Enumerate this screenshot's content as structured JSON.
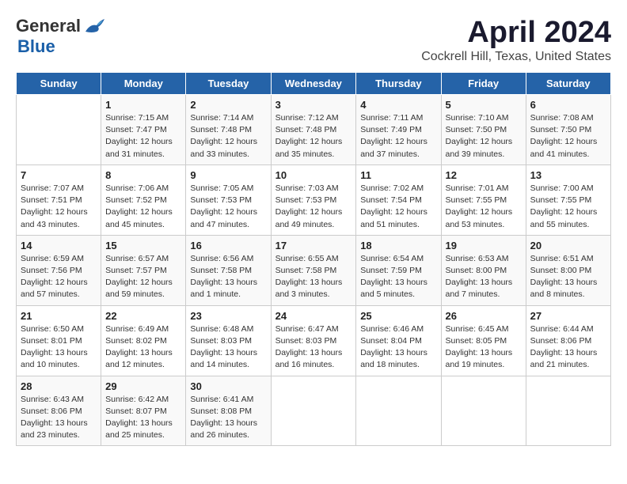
{
  "logo": {
    "general": "General",
    "blue": "Blue"
  },
  "title": "April 2024",
  "location": "Cockrell Hill, Texas, United States",
  "header_days": [
    "Sunday",
    "Monday",
    "Tuesday",
    "Wednesday",
    "Thursday",
    "Friday",
    "Saturday"
  ],
  "weeks": [
    [
      {
        "day": "",
        "info": ""
      },
      {
        "day": "1",
        "info": "Sunrise: 7:15 AM\nSunset: 7:47 PM\nDaylight: 12 hours\nand 31 minutes."
      },
      {
        "day": "2",
        "info": "Sunrise: 7:14 AM\nSunset: 7:48 PM\nDaylight: 12 hours\nand 33 minutes."
      },
      {
        "day": "3",
        "info": "Sunrise: 7:12 AM\nSunset: 7:48 PM\nDaylight: 12 hours\nand 35 minutes."
      },
      {
        "day": "4",
        "info": "Sunrise: 7:11 AM\nSunset: 7:49 PM\nDaylight: 12 hours\nand 37 minutes."
      },
      {
        "day": "5",
        "info": "Sunrise: 7:10 AM\nSunset: 7:50 PM\nDaylight: 12 hours\nand 39 minutes."
      },
      {
        "day": "6",
        "info": "Sunrise: 7:08 AM\nSunset: 7:50 PM\nDaylight: 12 hours\nand 41 minutes."
      }
    ],
    [
      {
        "day": "7",
        "info": "Sunrise: 7:07 AM\nSunset: 7:51 PM\nDaylight: 12 hours\nand 43 minutes."
      },
      {
        "day": "8",
        "info": "Sunrise: 7:06 AM\nSunset: 7:52 PM\nDaylight: 12 hours\nand 45 minutes."
      },
      {
        "day": "9",
        "info": "Sunrise: 7:05 AM\nSunset: 7:53 PM\nDaylight: 12 hours\nand 47 minutes."
      },
      {
        "day": "10",
        "info": "Sunrise: 7:03 AM\nSunset: 7:53 PM\nDaylight: 12 hours\nand 49 minutes."
      },
      {
        "day": "11",
        "info": "Sunrise: 7:02 AM\nSunset: 7:54 PM\nDaylight: 12 hours\nand 51 minutes."
      },
      {
        "day": "12",
        "info": "Sunrise: 7:01 AM\nSunset: 7:55 PM\nDaylight: 12 hours\nand 53 minutes."
      },
      {
        "day": "13",
        "info": "Sunrise: 7:00 AM\nSunset: 7:55 PM\nDaylight: 12 hours\nand 55 minutes."
      }
    ],
    [
      {
        "day": "14",
        "info": "Sunrise: 6:59 AM\nSunset: 7:56 PM\nDaylight: 12 hours\nand 57 minutes."
      },
      {
        "day": "15",
        "info": "Sunrise: 6:57 AM\nSunset: 7:57 PM\nDaylight: 12 hours\nand 59 minutes."
      },
      {
        "day": "16",
        "info": "Sunrise: 6:56 AM\nSunset: 7:58 PM\nDaylight: 13 hours\nand 1 minute."
      },
      {
        "day": "17",
        "info": "Sunrise: 6:55 AM\nSunset: 7:58 PM\nDaylight: 13 hours\nand 3 minutes."
      },
      {
        "day": "18",
        "info": "Sunrise: 6:54 AM\nSunset: 7:59 PM\nDaylight: 13 hours\nand 5 minutes."
      },
      {
        "day": "19",
        "info": "Sunrise: 6:53 AM\nSunset: 8:00 PM\nDaylight: 13 hours\nand 7 minutes."
      },
      {
        "day": "20",
        "info": "Sunrise: 6:51 AM\nSunset: 8:00 PM\nDaylight: 13 hours\nand 8 minutes."
      }
    ],
    [
      {
        "day": "21",
        "info": "Sunrise: 6:50 AM\nSunset: 8:01 PM\nDaylight: 13 hours\nand 10 minutes."
      },
      {
        "day": "22",
        "info": "Sunrise: 6:49 AM\nSunset: 8:02 PM\nDaylight: 13 hours\nand 12 minutes."
      },
      {
        "day": "23",
        "info": "Sunrise: 6:48 AM\nSunset: 8:03 PM\nDaylight: 13 hours\nand 14 minutes."
      },
      {
        "day": "24",
        "info": "Sunrise: 6:47 AM\nSunset: 8:03 PM\nDaylight: 13 hours\nand 16 minutes."
      },
      {
        "day": "25",
        "info": "Sunrise: 6:46 AM\nSunset: 8:04 PM\nDaylight: 13 hours\nand 18 minutes."
      },
      {
        "day": "26",
        "info": "Sunrise: 6:45 AM\nSunset: 8:05 PM\nDaylight: 13 hours\nand 19 minutes."
      },
      {
        "day": "27",
        "info": "Sunrise: 6:44 AM\nSunset: 8:06 PM\nDaylight: 13 hours\nand 21 minutes."
      }
    ],
    [
      {
        "day": "28",
        "info": "Sunrise: 6:43 AM\nSunset: 8:06 PM\nDaylight: 13 hours\nand 23 minutes."
      },
      {
        "day": "29",
        "info": "Sunrise: 6:42 AM\nSunset: 8:07 PM\nDaylight: 13 hours\nand 25 minutes."
      },
      {
        "day": "30",
        "info": "Sunrise: 6:41 AM\nSunset: 8:08 PM\nDaylight: 13 hours\nand 26 minutes."
      },
      {
        "day": "",
        "info": ""
      },
      {
        "day": "",
        "info": ""
      },
      {
        "day": "",
        "info": ""
      },
      {
        "day": "",
        "info": ""
      }
    ]
  ]
}
